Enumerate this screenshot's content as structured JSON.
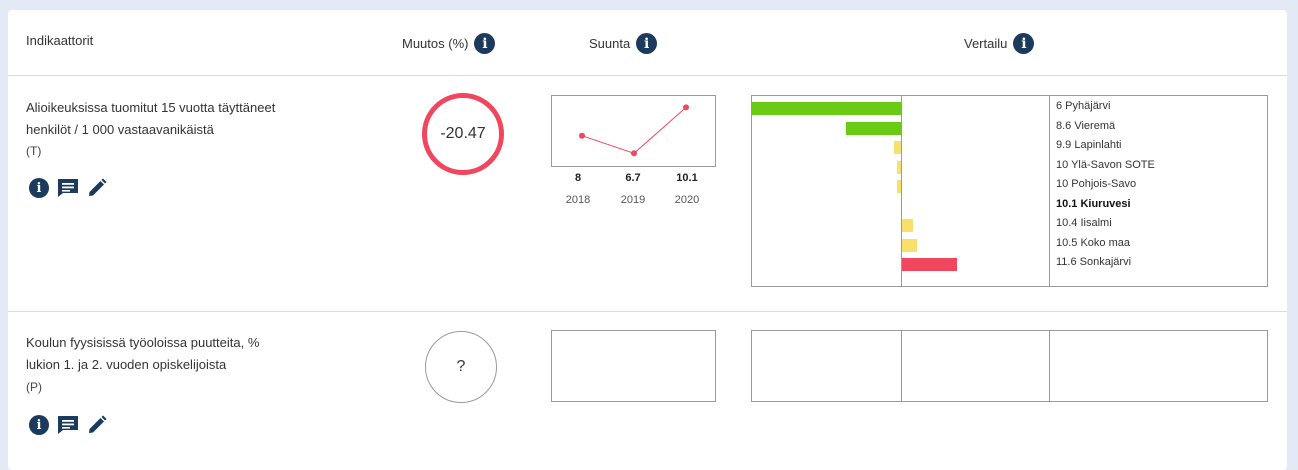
{
  "header": {
    "col_indicators": "Indikaattorit",
    "col_change": "Muutos (%)",
    "col_direction": "Suunta",
    "col_comparison": "Vertailu",
    "info_glyph": "i"
  },
  "colors": {
    "accent_negative": "#f0475e",
    "bar_green": "#6acb14",
    "bar_yellow": "#f8e06c",
    "bar_red": "#f0475e",
    "icon_navy": "#1b3a5c"
  },
  "rows": [
    {
      "name_line1": "Alioikeuksissa tuomitut 15 vuotta täyttäneet",
      "name_line2": "henkilöt / 1 000 vastaavanikäistä",
      "code": "(T)",
      "change": "-20.47",
      "trend": {
        "years": [
          "2018",
          "2019",
          "2020"
        ],
        "values": [
          "8",
          "6.7",
          "10.1"
        ],
        "numeric": [
          8,
          6.7,
          10.1
        ]
      },
      "comparison": [
        {
          "label": "6 Pyhäjärvi",
          "value": 6,
          "color": "green",
          "bold": false
        },
        {
          "label": "8.6 Vieremä",
          "value": 8.6,
          "color": "green",
          "bold": false
        },
        {
          "label": "9.9 Lapinlahti",
          "value": 9.9,
          "color": "yellow",
          "bold": false
        },
        {
          "label": "10 Ylä-Savon SOTE",
          "value": 10,
          "color": "yellow",
          "bold": false
        },
        {
          "label": "10 Pohjois-Savo",
          "value": 10,
          "color": "yellow",
          "bold": false
        },
        {
          "label": "10.1 Kiuruvesi",
          "value": 10.1,
          "color": "none",
          "bold": true
        },
        {
          "label": "10.4 Iisalmi",
          "value": 10.4,
          "color": "yellow",
          "bold": false
        },
        {
          "label": "10.5 Koko maa",
          "value": 10.5,
          "color": "yellow",
          "bold": false
        },
        {
          "label": "11.6 Sonkajärvi",
          "value": 11.6,
          "color": "red",
          "bold": false
        }
      ],
      "comparison_reference": 10.1,
      "icons": [
        "info-icon",
        "comment-icon",
        "edit-icon"
      ]
    },
    {
      "name_line1": "Koulun fyysisissä työoloissa puutteita, %",
      "name_line2": "lukion 1. ja 2. vuoden opiskelijoista",
      "code": "(P)",
      "change": "?",
      "icons": [
        "info-icon",
        "comment-icon",
        "edit-icon"
      ]
    }
  ]
}
